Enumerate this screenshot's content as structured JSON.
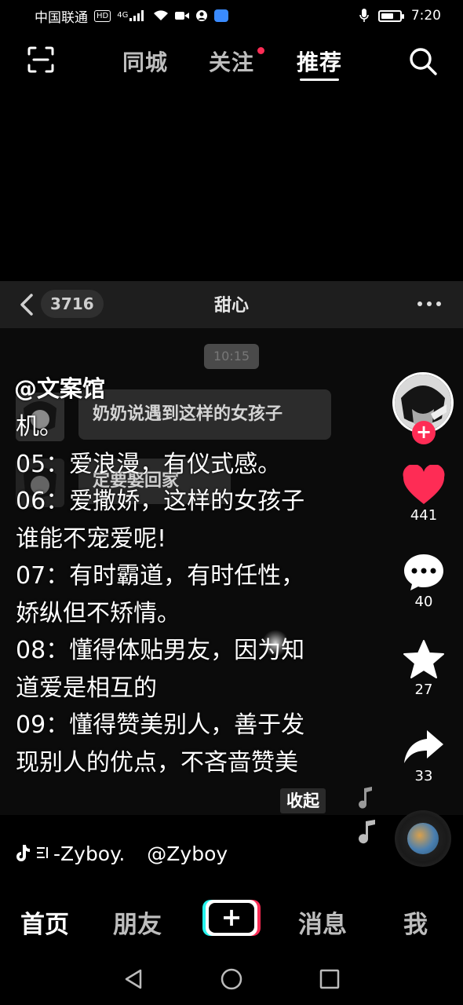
{
  "status_bar": {
    "carrier": "中国联通",
    "hd": "HD",
    "network": "4G",
    "time": "7:20",
    "battery_level": 0.7
  },
  "top_nav": {
    "tabs": [
      {
        "label": "同城",
        "active": false
      },
      {
        "label": "关注",
        "active": false,
        "has_dot": true
      },
      {
        "label": "推荐",
        "active": true
      }
    ],
    "scan_icon": "scan-icon",
    "search_icon": "search-icon"
  },
  "video": {
    "chat_screenshot": {
      "unread_count": "3716",
      "title": "甜心",
      "time_chip": "10:15",
      "bubble_1": "奶奶说遇到这样的女孩子",
      "bubble_2": "定要娶回家"
    },
    "author": "@文案馆",
    "description_lines": [
      "机。",
      "05：爱浪漫，有仪式感。",
      "06：爱撒娇，这样的女孩子",
      "谁能不宠爱呢!",
      "07：有时霸道，有时任性，",
      "娇纵但不矫情。",
      "08：懂得体贴男友，因为知",
      "道爱是相互的",
      "09：懂得赞美别人，善于发",
      "现别人的优点，不吝啬赞美"
    ],
    "collapse_label": "收起",
    "music_text": "-Zyboy.",
    "music_author": "@Zyboy"
  },
  "actions": {
    "likes": "441",
    "comments": "40",
    "favorites": "27",
    "shares": "33",
    "follow_symbol": "+"
  },
  "bottom_tabs": {
    "home": "首页",
    "friends": "朋友",
    "create": "+",
    "messages": "消息",
    "me": "我"
  },
  "colors": {
    "accent_red": "#fe2c55",
    "accent_cyan": "#25f4ee",
    "background": "#000000"
  }
}
